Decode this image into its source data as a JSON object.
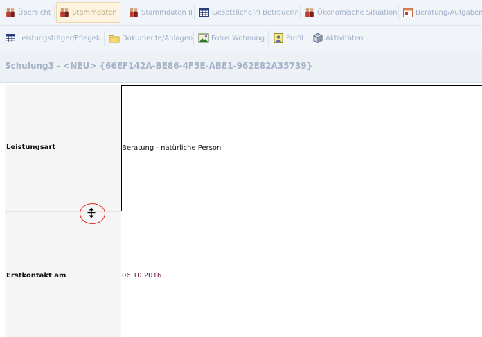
{
  "toolbar_row1": [
    {
      "label": "Übersicht",
      "icon": "people-icon",
      "active": false
    },
    {
      "label": "Stammdaten I",
      "icon": "people-icon",
      "active": true
    },
    {
      "label": "Stammdaten II",
      "icon": "people-icon",
      "active": false
    },
    {
      "label": "Gesetzliche(r) BetreuerIn",
      "icon": "grid-table-icon",
      "active": false
    },
    {
      "label": "Ökonomische Situation",
      "icon": "people-icon",
      "active": false
    },
    {
      "label": "Beratung/Aufgaben/",
      "icon": "calendar-icon",
      "active": false
    }
  ],
  "toolbar_row2": [
    {
      "label": "Leistungsträger/Pflegek.",
      "icon": "grid-table-icon"
    },
    {
      "label": "Dokumente/Anlagen",
      "icon": "folder-icon"
    },
    {
      "label": "Fotos Wohnung",
      "icon": "photo-icon"
    },
    {
      "label": "Profil",
      "icon": "profile-icon"
    },
    {
      "label": "Aktivitäten",
      "icon": "cube-icon"
    }
  ],
  "record": {
    "title": "Schulung3 - <NEU> {66EF142A-BE86-4F5E-ABE1-962E82A35739}"
  },
  "form": {
    "leistungsart_label": "Leistungsart",
    "leistungsart_value": "Beratung - natürliche Person",
    "erstkontakt_label": "Erstkontakt am",
    "erstkontakt_value": "06.10.2016"
  },
  "colors": {
    "annotation_circle": "#e0281f",
    "date_value": "#6a1040",
    "toolbar_text": "#9fb0c7"
  }
}
